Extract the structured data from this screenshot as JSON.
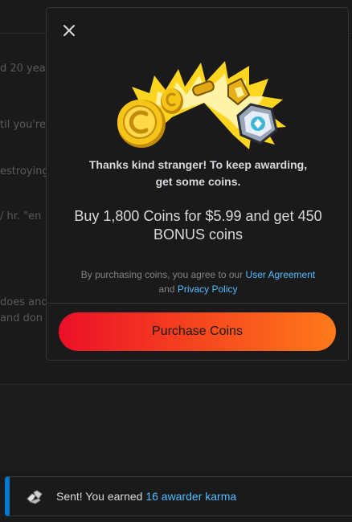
{
  "background": {
    "fragments": [
      "d 20 yea",
      "til you're",
      "estroying",
      "/ hr. \"en",
      "does and",
      "and don"
    ]
  },
  "modal": {
    "close_icon": "close-icon",
    "hero_art": "coins-and-awards-illustration",
    "thanks_line1": "Thanks kind stranger! To keep awarding,",
    "thanks_line2": "get some coins.",
    "offer_line1": "Buy 1,800 Coins for $5.99 and get 450",
    "offer_line2": "BONUS coins",
    "legal_prefix": "By purchasing coins, you agree to our ",
    "legal_link1": "User Agreement",
    "legal_mid": "and ",
    "legal_link2": "Privacy Policy",
    "purchase_label": "Purchase Coins"
  },
  "toast": {
    "icon": "awarder-hands-icon",
    "prefix": "Sent! You earned ",
    "link": "16 awarder karma"
  },
  "colors": {
    "accent_blue": "#4fbcff",
    "toast_bar": "#0079d3",
    "button_start": "#ec0f28",
    "button_end": "#ff7a1a"
  }
}
